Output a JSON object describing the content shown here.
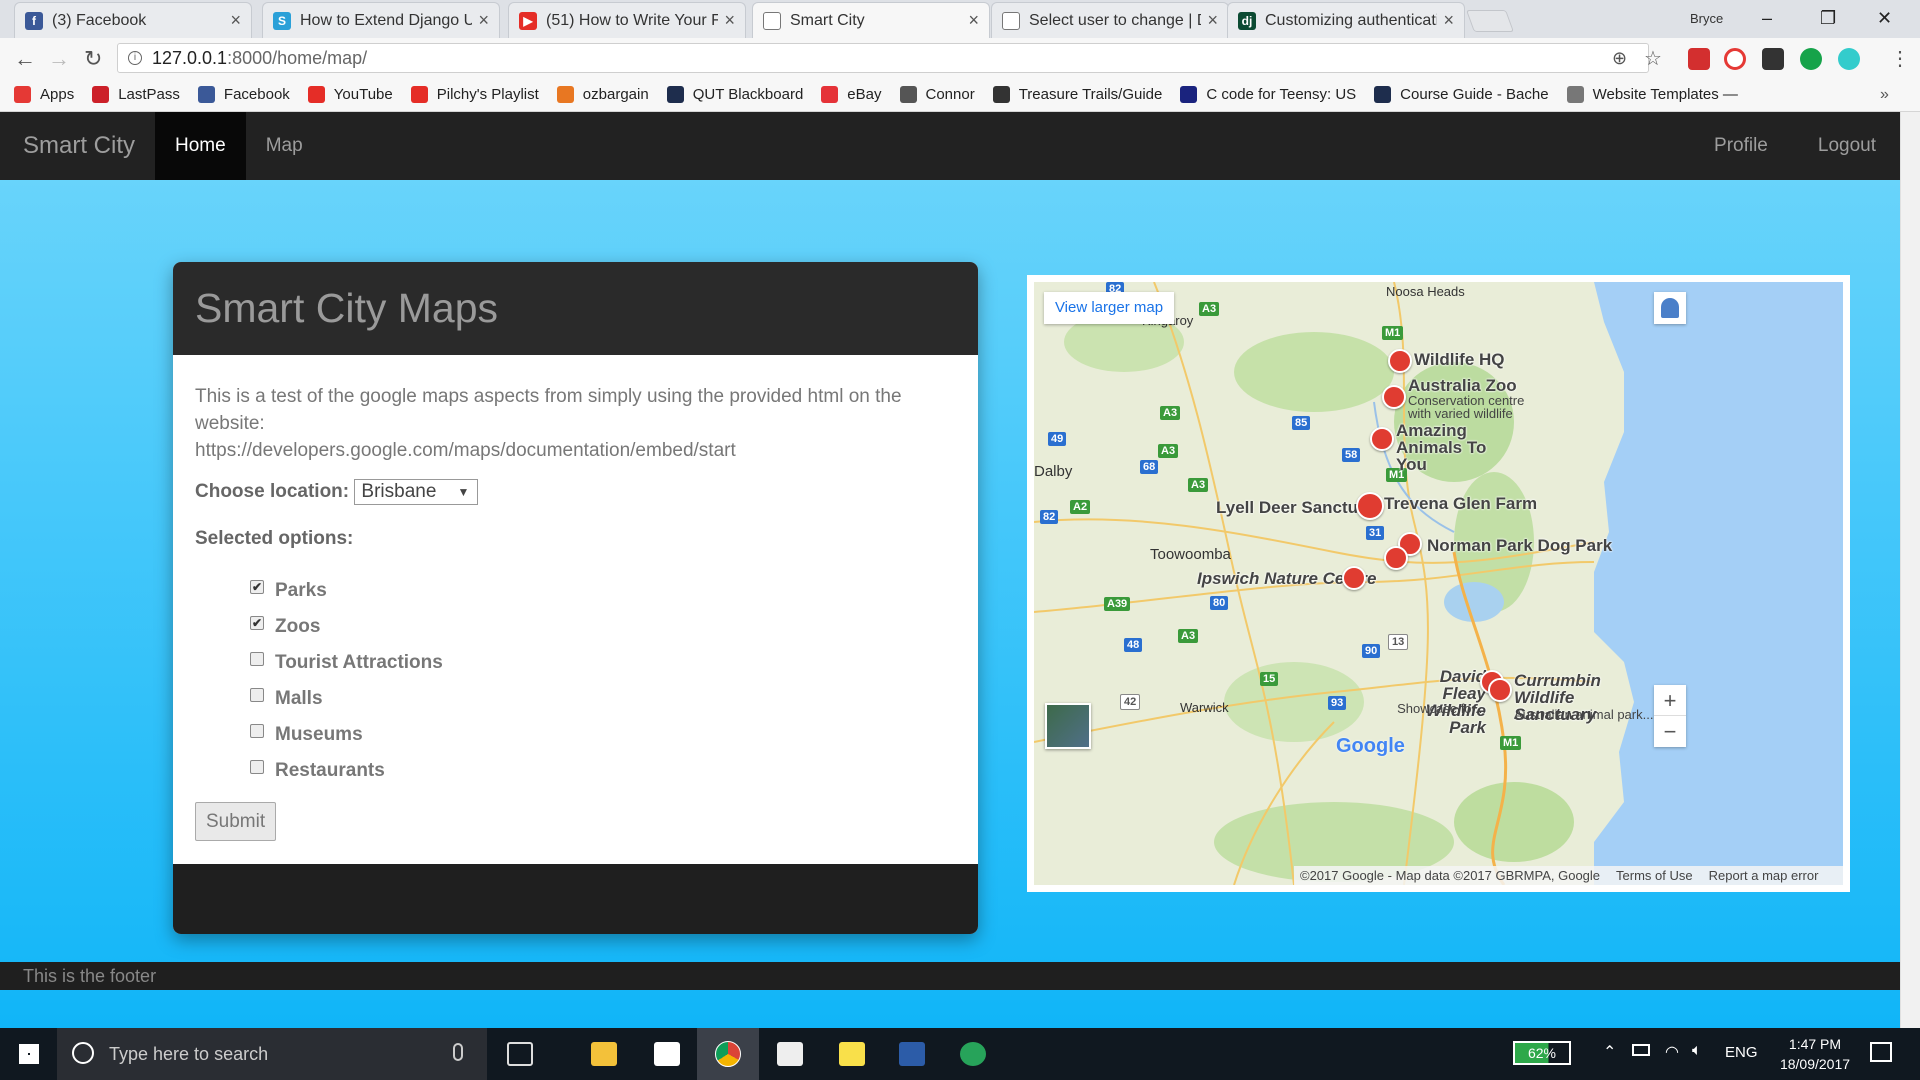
{
  "tabs": [
    {
      "title": "(3) Facebook",
      "icon": "facebook-icon",
      "color": "#3b5998",
      "glyph": "f"
    },
    {
      "title": "How to Extend Django U",
      "icon": "s-icon",
      "color": "#2aa0d8",
      "glyph": "S"
    },
    {
      "title": "(51) How to Write Your F",
      "icon": "youtube-icon",
      "color": "#e52d27",
      "glyph": "▶"
    },
    {
      "title": "Smart City",
      "icon": "page-icon",
      "color": "#ffffff",
      "glyph": ""
    },
    {
      "title": "Select user to change | D",
      "icon": "page-icon",
      "color": "#ffffff",
      "glyph": ""
    },
    {
      "title": "Customizing authenticati",
      "icon": "django-icon",
      "color": "#0c4b33",
      "glyph": "dj"
    }
  ],
  "window": {
    "user": "Bryce",
    "minimize": "–",
    "maximize": "❐",
    "close": "✕"
  },
  "address": {
    "url_host": "127.0.0.1",
    "url_rest": ":8000/home/map/"
  },
  "bookmarks": [
    {
      "label": "Apps",
      "icon": "apps-icon",
      "color": "#e53935"
    },
    {
      "label": "LastPass",
      "icon": "lastpass-icon",
      "color": "#cc2029"
    },
    {
      "label": "Facebook",
      "icon": "facebook-icon",
      "color": "#3b5998"
    },
    {
      "label": "YouTube",
      "icon": "youtube-icon",
      "color": "#e52d27"
    },
    {
      "label": "Pilchy's Playlist",
      "icon": "youtube-icon",
      "color": "#e52d27"
    },
    {
      "label": "ozbargain",
      "icon": "ozbargain-icon",
      "color": "#e87722"
    },
    {
      "label": "QUT Blackboard",
      "icon": "qut-icon",
      "color": "#1e2d4d"
    },
    {
      "label": "eBay",
      "icon": "ebay-icon",
      "color": "#e53238"
    },
    {
      "label": "Connor",
      "icon": "connor-icon",
      "color": "#555555"
    },
    {
      "label": "Treasure Trails/Guide",
      "icon": "treasure-icon",
      "color": "#333333"
    },
    {
      "label": "C code for Teensy: US",
      "icon": "teensy-icon",
      "color": "#1a237e"
    },
    {
      "label": "Course Guide - Bache",
      "icon": "qut-icon",
      "color": "#1e2d4d"
    },
    {
      "label": "Website Templates —",
      "icon": "templates-icon",
      "color": "#777777"
    }
  ],
  "bookmarks_more": "»",
  "nav": {
    "brand": "Smart City",
    "home": "Home",
    "map": "Map",
    "profile": "Profile",
    "logout": "Logout"
  },
  "card": {
    "title": "Smart City Maps",
    "intro": "This is a test of the google maps aspects from simply using the provided html on the website:",
    "link": "https://developers.google.com/maps/documentation/embed/start",
    "choose_label": "Choose location:",
    "location": "Brisbane",
    "selected_label": "Selected options:",
    "options": [
      {
        "label": "Parks",
        "checked": true
      },
      {
        "label": "Zoos",
        "checked": true
      },
      {
        "label": "Tourist Attractions",
        "checked": false
      },
      {
        "label": "Malls",
        "checked": false
      },
      {
        "label": "Museums",
        "checked": false
      },
      {
        "label": "Restaurants",
        "checked": false
      }
    ],
    "submit": "Submit"
  },
  "map": {
    "view_larger": "View larger map",
    "places": [
      {
        "label": "Noosa Heads"
      },
      {
        "label": "Kingaroy"
      },
      {
        "label": "Dalby"
      },
      {
        "label": "Toowoomba"
      },
      {
        "label": "Warwick"
      }
    ],
    "pois": [
      {
        "label": "Wildlife HQ"
      },
      {
        "label": "Australia Zoo",
        "sub": "Conservation centre with varied wildlife"
      },
      {
        "label": "Amazing Animals To You"
      },
      {
        "label": "Lyell Deer Sanctuary"
      },
      {
        "label": "Trevena Glen Farm"
      },
      {
        "label": "Norman Park Dog Park"
      },
      {
        "label": "Ipswich Nature Centre"
      },
      {
        "label": "David Fleay Wildlife Park",
        "sub": "Showcase for..."
      },
      {
        "label": "Currumbin Wildlife Sanctuary",
        "sub": "Australian animal park..."
      }
    ],
    "zoom_in": "+",
    "zoom_out": "−",
    "google": "Google",
    "attribution": "©2017 Google - Map data ©2017 GBRMPA, Google",
    "terms": "Terms of Use",
    "report": "Report a map error"
  },
  "footer": "This is the footer",
  "taskbar": {
    "search_placeholder": "Type here to search",
    "battery": "62%",
    "lang": "ENG",
    "time": "1:47 PM",
    "date": "18/09/2017"
  }
}
